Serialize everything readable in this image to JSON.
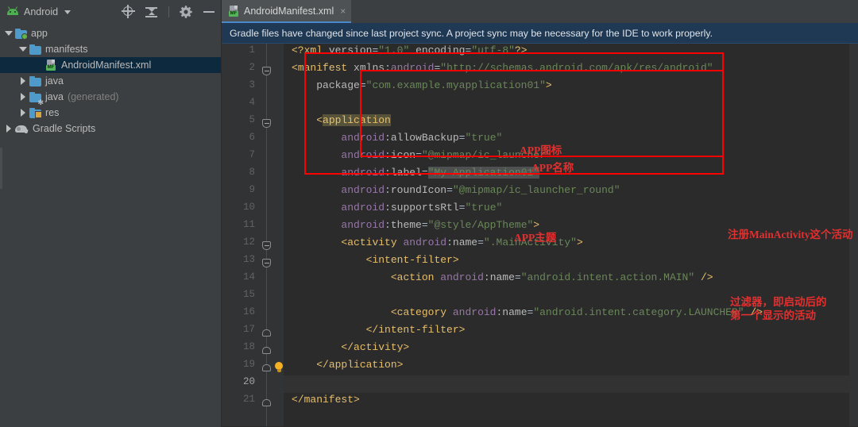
{
  "window": {
    "panel_title": "Android",
    "toolbar_icons": [
      "locate-target-icon",
      "collapse-all-icon",
      "settings-gear-icon",
      "minimize-icon"
    ]
  },
  "sidebar": {
    "items": [
      {
        "label": "app",
        "icon": "folder-module-icon",
        "expanded": true,
        "indent": 1,
        "twisty": "open",
        "dim": false
      },
      {
        "label": "manifests",
        "icon": "folder-icon",
        "expanded": true,
        "indent": 2,
        "twisty": "open",
        "dim": false
      },
      {
        "label": "AndroidManifest.xml",
        "icon": "manifest-file-icon",
        "expanded": false,
        "indent": 4,
        "twisty": "none",
        "dim": false,
        "selected": true
      },
      {
        "label": "java",
        "icon": "folder-icon",
        "expanded": false,
        "indent": 2,
        "twisty": "closed",
        "dim": false
      },
      {
        "label": "java",
        "suffix": "(generated)",
        "icon": "folder-generated-icon",
        "expanded": false,
        "indent": 2,
        "twisty": "closed",
        "dim": false
      },
      {
        "label": "res",
        "icon": "folder-res-icon",
        "expanded": false,
        "indent": 2,
        "twisty": "closed",
        "dim": false
      },
      {
        "label": "Gradle Scripts",
        "icon": "gradle-elephant-icon",
        "expanded": false,
        "indent": 1,
        "twisty": "closed",
        "dim": false
      }
    ]
  },
  "editor": {
    "tab": {
      "label": "AndroidManifest.xml",
      "icon": "manifest-file-icon",
      "close": "×"
    },
    "banner": "Gradle files have changed since last project sync. A project sync may be necessary for the IDE to work properly.",
    "current_line": 20,
    "lines": [
      {
        "n": 1,
        "fold": null,
        "bulb": false
      },
      {
        "n": 2,
        "fold": "minus",
        "bulb": false
      },
      {
        "n": 3,
        "fold": null,
        "bulb": false
      },
      {
        "n": 4,
        "fold": null,
        "bulb": false
      },
      {
        "n": 5,
        "fold": "minus",
        "bulb": false
      },
      {
        "n": 6,
        "fold": null,
        "bulb": false
      },
      {
        "n": 7,
        "fold": null,
        "bulb": false
      },
      {
        "n": 8,
        "fold": null,
        "bulb": false
      },
      {
        "n": 9,
        "fold": null,
        "bulb": false
      },
      {
        "n": 10,
        "fold": null,
        "bulb": false
      },
      {
        "n": 11,
        "fold": null,
        "bulb": false
      },
      {
        "n": 12,
        "fold": "minus",
        "bulb": false
      },
      {
        "n": 13,
        "fold": "minus",
        "bulb": false
      },
      {
        "n": 14,
        "fold": null,
        "bulb": false
      },
      {
        "n": 15,
        "fold": null,
        "bulb": false
      },
      {
        "n": 16,
        "fold": null,
        "bulb": false
      },
      {
        "n": 17,
        "fold": "end",
        "bulb": false
      },
      {
        "n": 18,
        "fold": "end",
        "bulb": false
      },
      {
        "n": 19,
        "fold": "end",
        "bulb": true
      },
      {
        "n": 20,
        "fold": null,
        "bulb": false
      },
      {
        "n": 21,
        "fold": "end",
        "bulb": false
      }
    ],
    "code": [
      "<?xml version=\"1.0\" encoding=\"utf-8\"?>",
      "<manifest xmlns:android=\"http://schemas.android.com/apk/res/android\"",
      "    package=\"com.example.myapplication01\">",
      "",
      "    <application",
      "        android:allowBackup=\"true\"",
      "        android:icon=\"@mipmap/ic_launcher\"",
      "        android:label=\"My Application01\"",
      "        android:roundIcon=\"@mipmap/ic_launcher_round\"",
      "        android:supportsRtl=\"true\"",
      "        android:theme=\"@style/AppTheme\">",
      "        <activity android:name=\".MainActivity\">",
      "            <intent-filter>",
      "                <action android:name=\"android.intent.action.MAIN\" />",
      "",
      "                <category android:name=\"android.intent.category.LAUNCHER\" />",
      "            </intent-filter>",
      "        </activity>",
      "    </application>",
      "",
      "</manifest>"
    ]
  },
  "annotations": {
    "color": "#e03030",
    "rect_color": "#ff0000",
    "notes": [
      {
        "id": "app-icon-note",
        "text": "APP图标"
      },
      {
        "id": "app-name-note",
        "text": "APP名称"
      },
      {
        "id": "app-theme-note",
        "text": "APP主题"
      },
      {
        "id": "register-activity-note",
        "text": "注册MainActivity这个活动"
      },
      {
        "id": "intent-filter-note-line1",
        "text": "过滤器，即启动后的"
      },
      {
        "id": "intent-filter-note-line2",
        "text": "第一个显示的活动"
      }
    ]
  }
}
